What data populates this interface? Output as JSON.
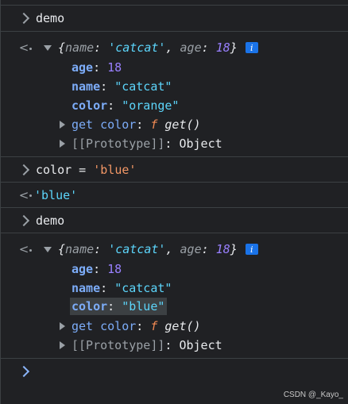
{
  "entries": {
    "demo1": "demo",
    "obj1": {
      "preview_open": "{",
      "k_name": "name",
      "colon1": ": ",
      "v_name": "'catcat'",
      "comma": ", ",
      "k_age": "age",
      "colon2": ": ",
      "v_age": "18",
      "preview_close": "}",
      "info": "i",
      "age_key": "age",
      "age_val": "18",
      "name_key": "name",
      "name_val": "\"catcat\"",
      "color_key": "color",
      "color_val": "\"orange\"",
      "getter_label": "get color",
      "getter_f": "f",
      "getter_fn": "get()",
      "proto_label": "[[Prototype]]",
      "proto_val": "Object"
    },
    "assign_cmd_left": "color = ",
    "assign_cmd_str": "'blue'",
    "assign_result": "'blue'",
    "demo2": "demo",
    "obj2": {
      "preview_open": "{",
      "k_name": "name",
      "colon1": ": ",
      "v_name": "'catcat'",
      "comma": ", ",
      "k_age": "age",
      "colon2": ": ",
      "v_age": "18",
      "preview_close": "}",
      "info": "i",
      "age_key": "age",
      "age_val": "18",
      "name_key": "name",
      "name_val": "\"catcat\"",
      "color_key": "color",
      "color_val": "\"blue\"",
      "getter_label": "get color",
      "getter_f": "f",
      "getter_fn": "get()",
      "proto_label": "[[Prototype]]",
      "proto_val": "Object"
    }
  },
  "watermark": "CSDN @_Kayo_",
  "colors": {
    "background": "#202124",
    "string": "#5cd5fb",
    "number": "#9980ff",
    "key": "#7cacf8",
    "function": "#f28b54"
  }
}
